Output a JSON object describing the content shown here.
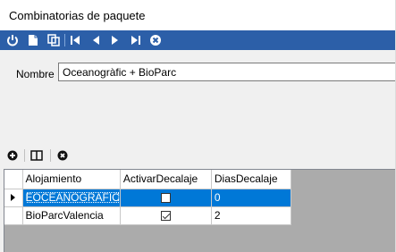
{
  "window": {
    "title": "Combinatorias de paquete"
  },
  "toolbar": {
    "buttons": [
      {
        "icon": "power-icon"
      },
      {
        "icon": "new-document-icon"
      },
      {
        "icon": "copy-icon"
      },
      {
        "icon": "first-record-icon"
      },
      {
        "icon": "previous-record-icon"
      },
      {
        "icon": "next-record-icon"
      },
      {
        "icon": "last-record-icon"
      },
      {
        "icon": "delete-icon"
      }
    ]
  },
  "form": {
    "nombre_label": "Nombre",
    "nombre_value": "Oceanogràfic + BioParc"
  },
  "grid_toolbar": {
    "buttons": [
      {
        "icon": "add-icon"
      },
      {
        "icon": "columns-icon"
      },
      {
        "icon": "remove-icon"
      }
    ]
  },
  "grid": {
    "columns": [
      "Alojamiento",
      "ActivarDecalaje",
      "DiasDecalaje"
    ],
    "rows": [
      {
        "alojamiento": "EOCEANOGRAFIC",
        "activar_decalaje": false,
        "dias_decalaje": "0",
        "selected": true
      },
      {
        "alojamiento": "BioParcValencia",
        "activar_decalaje": true,
        "dias_decalaje": "2",
        "selected": false
      }
    ]
  },
  "colors": {
    "toolbar_bg": "#2c5fa8",
    "selection": "#0078d7"
  }
}
